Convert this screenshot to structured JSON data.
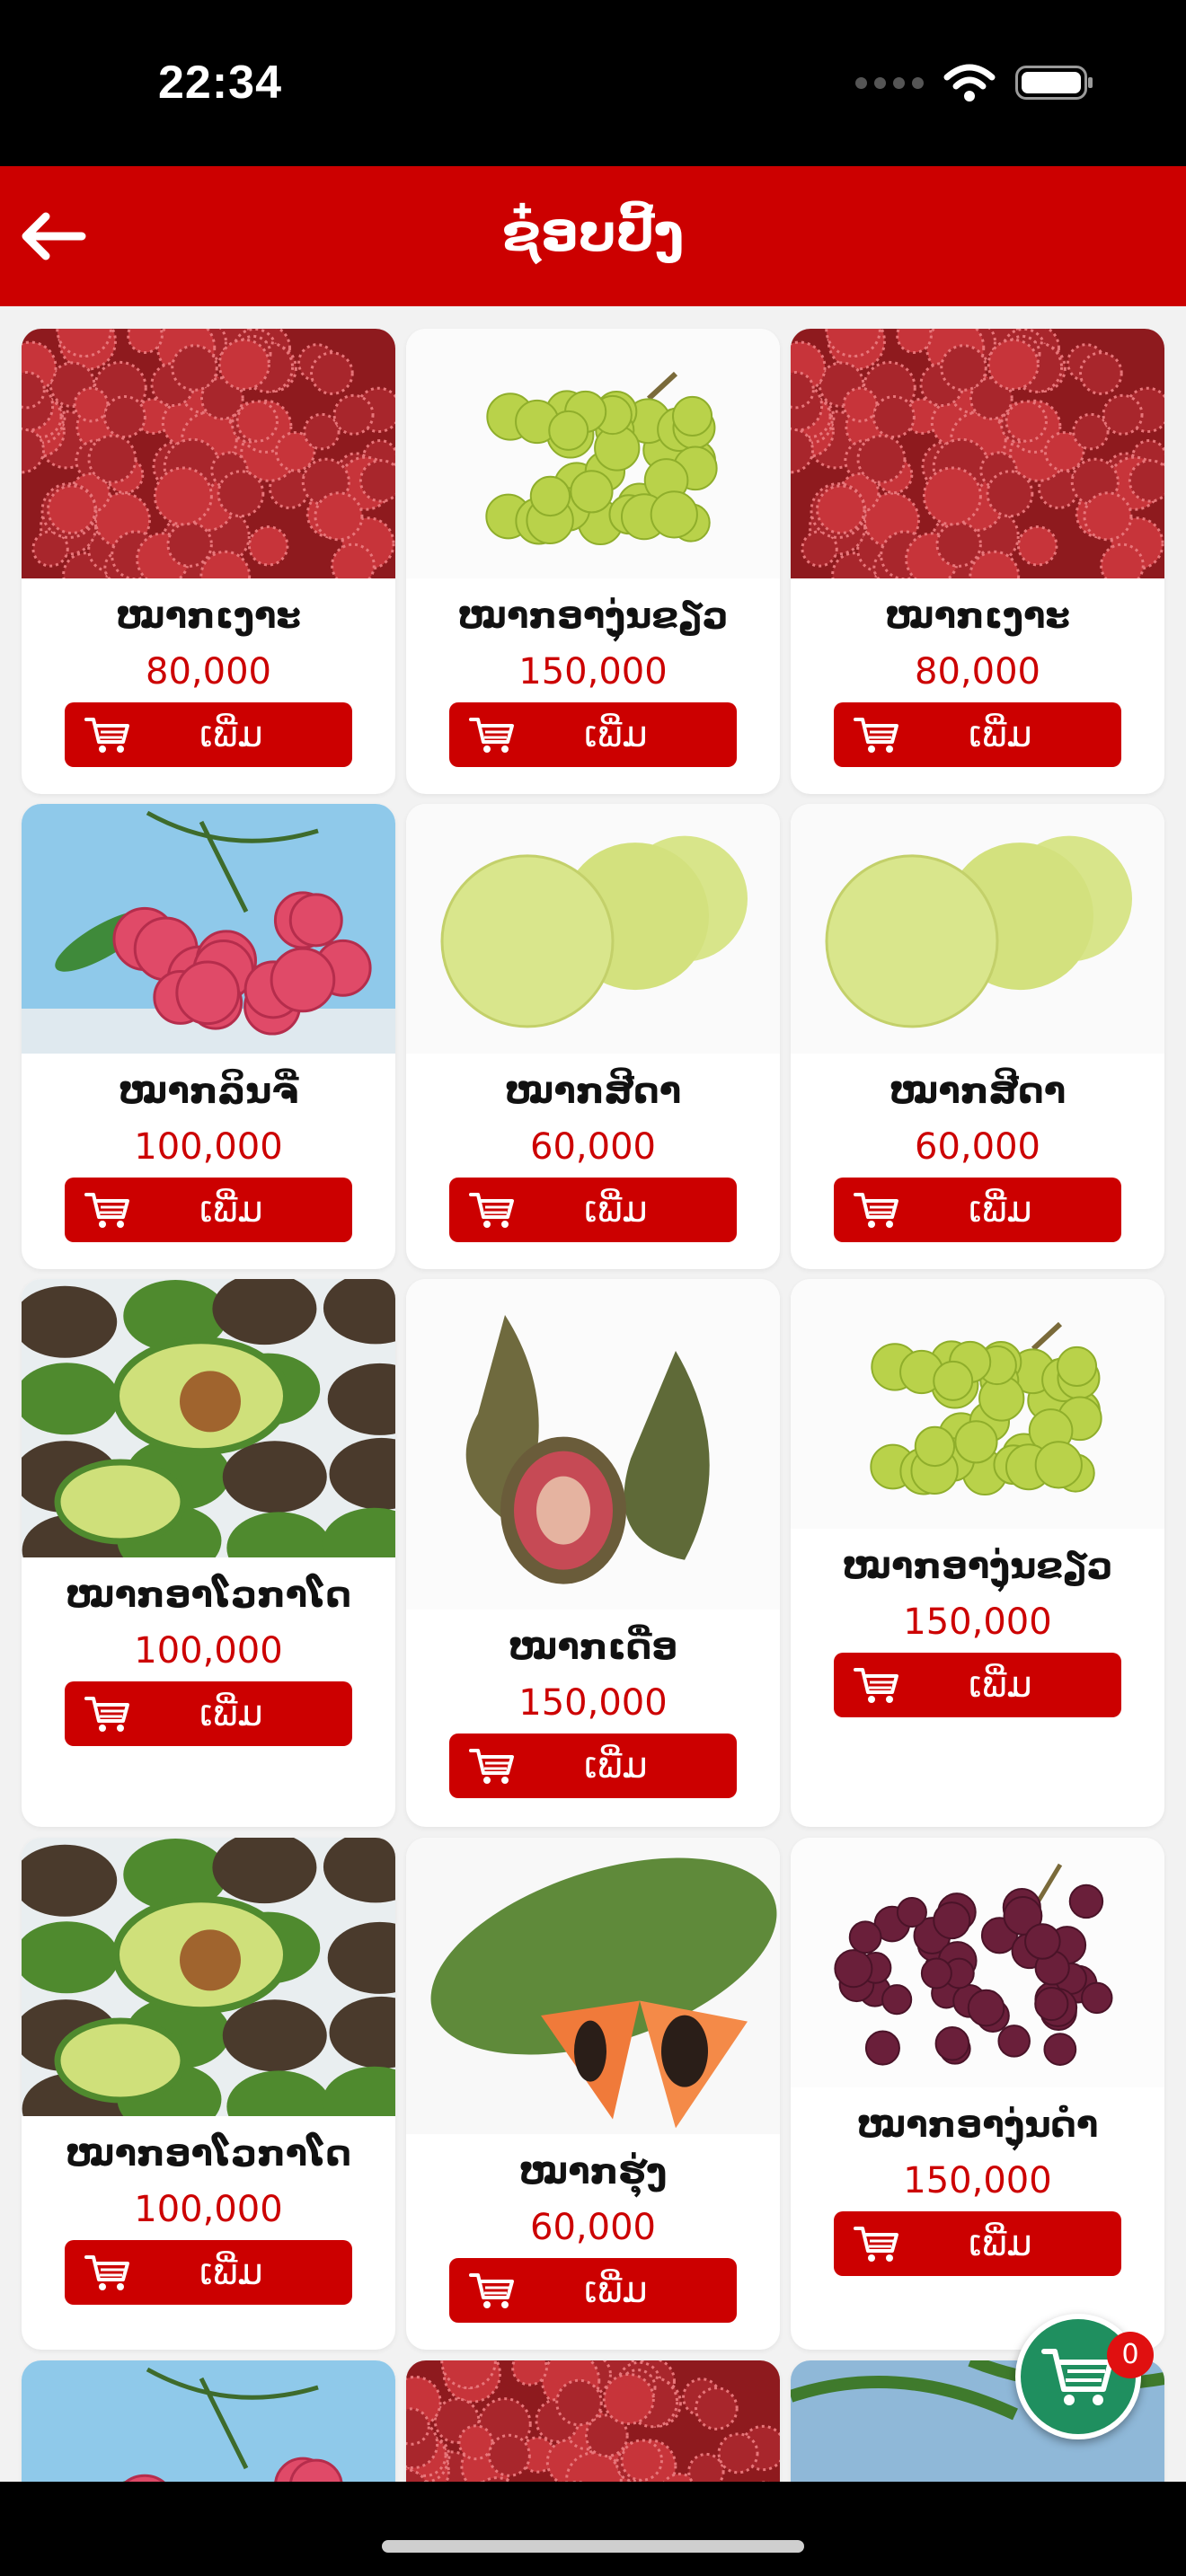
{
  "status_bar": {
    "time": "22:34"
  },
  "header": {
    "title": "ຊ໋ອບປີ້ງ",
    "back_icon": "arrow-left-icon"
  },
  "add_label": "ເພີ່ມ",
  "products": [
    {
      "name": "ໝາກເງາະ",
      "price": "80,000",
      "image": "rambutan"
    },
    {
      "name": "ໝາກອາງຸ່ນຂຽວ",
      "price": "150,000",
      "image": "green-grapes"
    },
    {
      "name": "ໝາກເງາະ",
      "price": "80,000",
      "image": "rambutan"
    },
    {
      "name": "ໝາກລິນຈີ່",
      "price": "100,000",
      "image": "lychee"
    },
    {
      "name": "ໝາກສີດາ",
      "price": "60,000",
      "image": "guava"
    },
    {
      "name": "ໝາກສີດາ",
      "price": "60,000",
      "image": "guava"
    },
    {
      "name": "ໝາກອາໂວກາໂດ",
      "price": "100,000",
      "image": "avocado"
    },
    {
      "name": "ໝາກເດື່ອ",
      "price": "150,000",
      "image": "fig"
    },
    {
      "name": "ໝາກອາງຸ່ນຂຽວ",
      "price": "150,000",
      "image": "green-grapes"
    },
    {
      "name": "ໝາກອາໂວກາໂດ",
      "price": "100,000",
      "image": "avocado"
    },
    {
      "name": "ໝາກຮຸ່ງ",
      "price": "60,000",
      "image": "papaya"
    },
    {
      "name": "ໝາກອາງຸ່ນດຳ",
      "price": "150,000",
      "image": "black-grapes"
    },
    {
      "name": "",
      "price": "",
      "image": "lychee"
    },
    {
      "name": "",
      "price": "",
      "image": "rambutan"
    },
    {
      "name": "",
      "price": "",
      "image": "coconut"
    }
  ],
  "cart": {
    "count": "0",
    "icon": "cart-icon"
  },
  "colors": {
    "primary": "#cc0000",
    "cart_fab": "#1f8f5f"
  }
}
